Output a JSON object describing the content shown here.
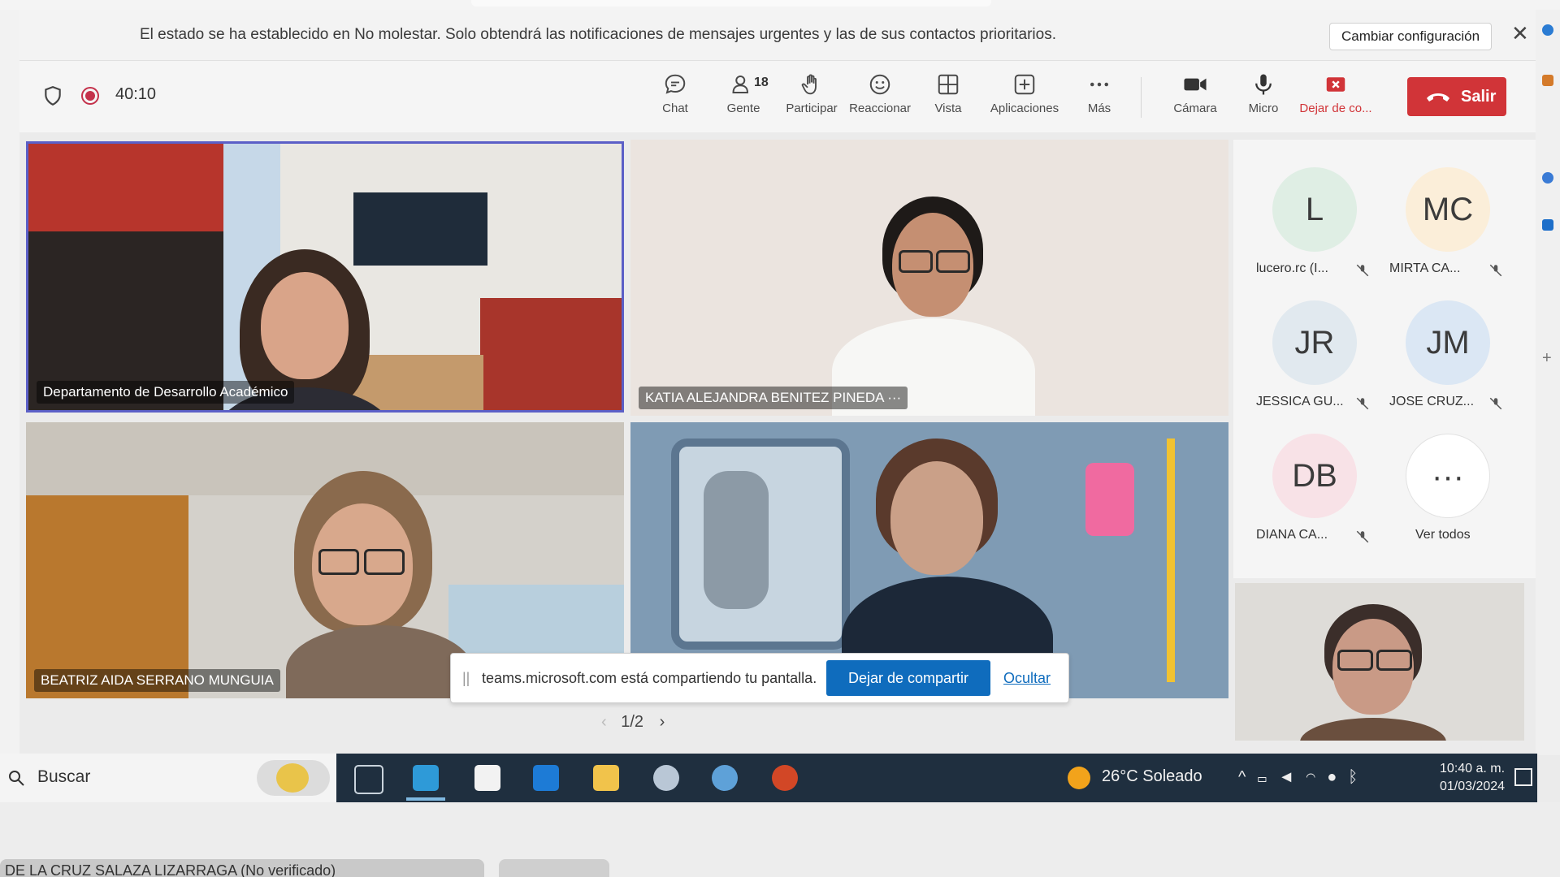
{
  "notification": {
    "text": "El estado se ha establecido en No molestar. Solo obtendrá las notificaciones de mensajes urgentes y las de sus contactos prioritarios.",
    "button": "Cambiar configuración",
    "close": "✕"
  },
  "toolbar": {
    "timer": "40:10",
    "people_count": "18",
    "items": {
      "chat": "Chat",
      "people": "Gente",
      "raise": "Participar",
      "react": "Reaccionar",
      "view": "Vista",
      "apps": "Aplicaciones",
      "more": "Más",
      "camera": "Cámara",
      "mic": "Micro",
      "share": "Dejar de co..."
    },
    "leave": "Salir"
  },
  "tiles": [
    {
      "name": "Departamento de Desarrollo Académico"
    },
    {
      "name": "KATIA ALEJANDRA BENITEZ PINEDA",
      "more": "···"
    },
    {
      "name": "BEATRIZ AIDA SERRANO MUNGUIA"
    },
    {
      "name": ""
    }
  ],
  "participants": [
    {
      "initials": "L",
      "name": "lucero.rc (I...",
      "color": "#dfeee4"
    },
    {
      "initials": "MC",
      "name": "MIRTA CA...",
      "color": "#fbeed9"
    },
    {
      "initials": "JR",
      "name": "JESSICA GU...",
      "color": "#e1e9ef"
    },
    {
      "initials": "JM",
      "name": "JOSE CRUZ...",
      "color": "#dbe7f4"
    },
    {
      "initials": "DB",
      "name": "DIANA CA...",
      "color": "#f8e2e7"
    }
  ],
  "see_all": {
    "icon": "···",
    "label": "Ver todos"
  },
  "share_bar": {
    "grip": "||",
    "message": "teams.microsoft.com está compartiendo tu pantalla.",
    "stop": "Dejar de compartir",
    "hide": "Ocultar"
  },
  "pager": {
    "page": "1/2"
  },
  "taskbar": {
    "search": "Buscar",
    "weather": "26°C  Soleado",
    "time": "10:40 a. m.",
    "date": "01/03/2024"
  },
  "bottom_tab": "DE LA CRUZ SALAZA LIZARRAGA (No verificado)",
  "colors": {
    "leave": "#d13438",
    "accent": "#0f6cbd",
    "record": "#c4314b",
    "tile_border": "#5b5fc7"
  }
}
